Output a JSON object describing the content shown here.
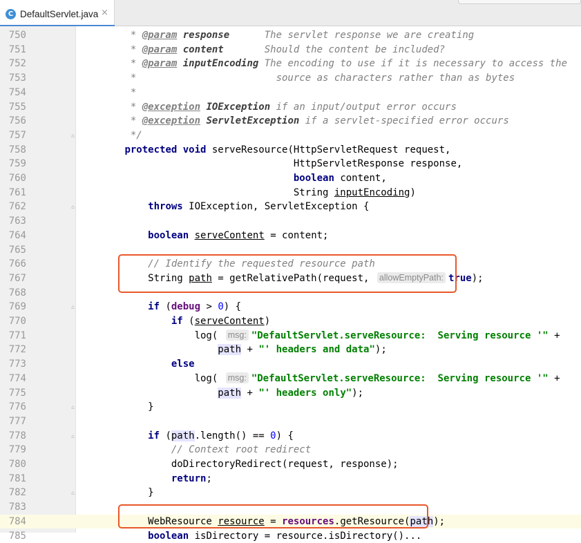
{
  "editor": {
    "tab": {
      "icon": "C",
      "label": "DefaultServlet.java",
      "close": "×"
    }
  },
  "lines": [
    {
      "number": 750,
      "fold": false,
      "caret": false,
      "tokens": [
        [
          "cm",
          "         * "
        ],
        [
          "dt",
          "@param"
        ],
        [
          "cm",
          " "
        ],
        [
          "dp",
          "response"
        ],
        [
          "cm",
          "      The servlet response we are creating"
        ]
      ]
    },
    {
      "number": 751,
      "fold": false,
      "caret": false,
      "tokens": [
        [
          "cm",
          "         * "
        ],
        [
          "dt",
          "@param"
        ],
        [
          "cm",
          " "
        ],
        [
          "dp",
          "content"
        ],
        [
          "cm",
          "       Should the content be included?"
        ]
      ]
    },
    {
      "number": 752,
      "fold": false,
      "caret": false,
      "tokens": [
        [
          "cm",
          "         * "
        ],
        [
          "dt",
          "@param"
        ],
        [
          "cm",
          " "
        ],
        [
          "dp",
          "inputEncoding"
        ],
        [
          "cm",
          " The encoding to use if it is necessary to access the"
        ]
      ]
    },
    {
      "number": 753,
      "fold": false,
      "caret": false,
      "tokens": [
        [
          "cm",
          "         *                        source as characters rather than as bytes"
        ]
      ]
    },
    {
      "number": 754,
      "fold": false,
      "caret": false,
      "tokens": [
        [
          "cm",
          "         *"
        ]
      ]
    },
    {
      "number": 755,
      "fold": false,
      "caret": false,
      "tokens": [
        [
          "cm",
          "         * "
        ],
        [
          "dt",
          "@exception"
        ],
        [
          "cm",
          " "
        ],
        [
          "dp",
          "IOException"
        ],
        [
          "cm",
          " if an input/output error occurs"
        ]
      ]
    },
    {
      "number": 756,
      "fold": false,
      "caret": false,
      "tokens": [
        [
          "cm",
          "         * "
        ],
        [
          "dt",
          "@exception"
        ],
        [
          "cm",
          " "
        ],
        [
          "dp",
          "ServletException"
        ],
        [
          "cm",
          " if a servlet-specified error occurs"
        ]
      ]
    },
    {
      "number": 757,
      "fold": true,
      "caret": false,
      "tokens": [
        [
          "cm",
          "         */"
        ]
      ]
    },
    {
      "number": 758,
      "fold": false,
      "caret": false,
      "tokens": [
        [
          "txt",
          "        "
        ],
        [
          "kw",
          "protected"
        ],
        [
          "txt",
          " "
        ],
        [
          "kw",
          "void"
        ],
        [
          "txt",
          " serveResource(HttpServletRequest request,"
        ]
      ]
    },
    {
      "number": 759,
      "fold": false,
      "caret": false,
      "tokens": [
        [
          "txt",
          "                                     HttpServletResponse response,"
        ]
      ]
    },
    {
      "number": 760,
      "fold": false,
      "caret": false,
      "tokens": [
        [
          "txt",
          "                                     "
        ],
        [
          "kw",
          "boolean"
        ],
        [
          "txt",
          " content,"
        ]
      ]
    },
    {
      "number": 761,
      "fold": false,
      "caret": false,
      "tokens": [
        [
          "txt",
          "                                     String "
        ],
        [
          "ul",
          "inputEncoding"
        ],
        [
          "txt",
          ")"
        ]
      ]
    },
    {
      "number": 762,
      "fold": true,
      "caret": false,
      "tokens": [
        [
          "txt",
          "            "
        ],
        [
          "kw",
          "throws"
        ],
        [
          "txt",
          " IOException, ServletException {"
        ]
      ]
    },
    {
      "number": 763,
      "fold": false,
      "caret": false,
      "tokens": []
    },
    {
      "number": 764,
      "fold": false,
      "caret": false,
      "tokens": [
        [
          "txt",
          "            "
        ],
        [
          "kw",
          "boolean"
        ],
        [
          "txt",
          " "
        ],
        [
          "ul",
          "serveContent"
        ],
        [
          "txt",
          " = content;"
        ]
      ]
    },
    {
      "number": 765,
      "fold": false,
      "caret": false,
      "tokens": []
    },
    {
      "number": 766,
      "fold": false,
      "caret": false,
      "tokens": [
        [
          "cm",
          "            // Identify the requested resource path"
        ]
      ]
    },
    {
      "number": 767,
      "fold": false,
      "caret": false,
      "tokens": [
        [
          "txt",
          "            String "
        ],
        [
          "ul",
          "path"
        ],
        [
          "txt",
          " = getRelativePath(request, "
        ],
        [
          "hint",
          "allowEmptyPath:"
        ],
        [
          "kw",
          "true"
        ],
        [
          "txt",
          ");"
        ]
      ]
    },
    {
      "number": 768,
      "fold": false,
      "caret": false,
      "tokens": []
    },
    {
      "number": 769,
      "fold": true,
      "caret": false,
      "tokens": [
        [
          "txt",
          "            "
        ],
        [
          "kw",
          "if"
        ],
        [
          "txt",
          " ("
        ],
        [
          "fld",
          "debug"
        ],
        [
          "txt",
          " > "
        ],
        [
          "num",
          "0"
        ],
        [
          "txt",
          ") {"
        ]
      ]
    },
    {
      "number": 770,
      "fold": false,
      "caret": false,
      "tokens": [
        [
          "txt",
          "                "
        ],
        [
          "kw",
          "if"
        ],
        [
          "txt",
          " ("
        ],
        [
          "ul",
          "serveContent"
        ],
        [
          "txt",
          ")"
        ]
      ]
    },
    {
      "number": 771,
      "fold": false,
      "caret": false,
      "tokens": [
        [
          "txt",
          "                    log( "
        ],
        [
          "hint",
          "msg:"
        ],
        [
          "str",
          "\"DefaultServlet.serveResource:  Serving resource '\""
        ],
        [
          "txt",
          " +"
        ]
      ]
    },
    {
      "number": 772,
      "fold": false,
      "caret": false,
      "tokens": [
        [
          "txt",
          "                        "
        ],
        [
          "ref",
          "path"
        ],
        [
          "txt",
          " + "
        ],
        [
          "str",
          "\"' headers and data\""
        ],
        [
          "txt",
          ");"
        ]
      ]
    },
    {
      "number": 773,
      "fold": false,
      "caret": false,
      "tokens": [
        [
          "txt",
          "                "
        ],
        [
          "kw",
          "else"
        ]
      ]
    },
    {
      "number": 774,
      "fold": false,
      "caret": false,
      "tokens": [
        [
          "txt",
          "                    log( "
        ],
        [
          "hint",
          "msg:"
        ],
        [
          "str",
          "\"DefaultServlet.serveResource:  Serving resource '\""
        ],
        [
          "txt",
          " +"
        ]
      ]
    },
    {
      "number": 775,
      "fold": false,
      "caret": false,
      "tokens": [
        [
          "txt",
          "                        "
        ],
        [
          "ref",
          "path"
        ],
        [
          "txt",
          " + "
        ],
        [
          "str",
          "\"' headers only\""
        ],
        [
          "txt",
          ");"
        ]
      ]
    },
    {
      "number": 776,
      "fold": true,
      "caret": false,
      "tokens": [
        [
          "txt",
          "            }"
        ]
      ]
    },
    {
      "number": 777,
      "fold": false,
      "caret": false,
      "tokens": []
    },
    {
      "number": 778,
      "fold": true,
      "caret": false,
      "tokens": [
        [
          "txt",
          "            "
        ],
        [
          "kw",
          "if"
        ],
        [
          "txt",
          " ("
        ],
        [
          "ref",
          "path"
        ],
        [
          "txt",
          ".length() == "
        ],
        [
          "num",
          "0"
        ],
        [
          "txt",
          ") {"
        ]
      ]
    },
    {
      "number": 779,
      "fold": false,
      "caret": false,
      "tokens": [
        [
          "cm",
          "                // Context root redirect"
        ]
      ]
    },
    {
      "number": 780,
      "fold": false,
      "caret": false,
      "tokens": [
        [
          "txt",
          "                doDirectoryRedirect(request, response);"
        ]
      ]
    },
    {
      "number": 781,
      "fold": false,
      "caret": false,
      "tokens": [
        [
          "txt",
          "                "
        ],
        [
          "kw",
          "return"
        ],
        [
          "txt",
          ";"
        ]
      ]
    },
    {
      "number": 782,
      "fold": true,
      "caret": false,
      "tokens": [
        [
          "txt",
          "            }"
        ]
      ]
    },
    {
      "number": 783,
      "fold": false,
      "caret": false,
      "tokens": []
    },
    {
      "number": 784,
      "fold": false,
      "caret": true,
      "tokens": [
        [
          "txt",
          "            WebResource "
        ],
        [
          "ul",
          "resource"
        ],
        [
          "txt",
          " = "
        ],
        [
          "fld",
          "resources"
        ],
        [
          "txt",
          ".getResource("
        ],
        [
          "ref",
          "path"
        ],
        [
          "txt",
          ");"
        ]
      ]
    },
    {
      "number": 785,
      "fold": false,
      "caret": false,
      "tokens": [
        [
          "txt",
          "            "
        ],
        [
          "kw",
          "boolean"
        ],
        [
          "txt",
          " isDirectory = resource.isDirectory()..."
        ]
      ]
    }
  ],
  "colors": {
    "annotation_border": "#e8572a",
    "keyword": "#000080",
    "string": "#008000",
    "comment": "#808080",
    "field": "#660e7a",
    "number": "#0000ff"
  }
}
